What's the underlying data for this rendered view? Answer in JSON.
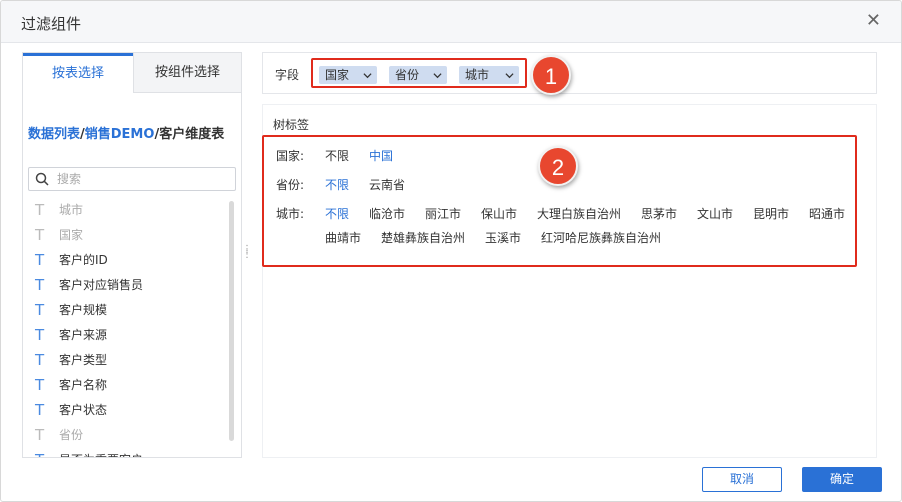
{
  "dialog": {
    "title": "过滤组件",
    "close_glyph": "✕"
  },
  "left_panel": {
    "tabs": [
      "按表选择",
      "按组件选择"
    ],
    "breadcrumb": {
      "part1": "数据列表",
      "sep1": "/",
      "part2": "销售DEMO",
      "sep2": "/",
      "current": "客户维度表"
    },
    "search_placeholder": "搜索",
    "field_type_glyph": "T",
    "fields": [
      {
        "label": "城市",
        "disabled": true
      },
      {
        "label": "国家",
        "disabled": true
      },
      {
        "label": "客户的ID",
        "disabled": false
      },
      {
        "label": "客户对应销售员",
        "disabled": false
      },
      {
        "label": "客户规模",
        "disabled": false
      },
      {
        "label": "客户来源",
        "disabled": false
      },
      {
        "label": "客户类型",
        "disabled": false
      },
      {
        "label": "客户名称",
        "disabled": false
      },
      {
        "label": "客户状态",
        "disabled": false
      },
      {
        "label": "省份",
        "disabled": true
      },
      {
        "label": "是否为重要客户",
        "disabled": false
      }
    ]
  },
  "field_bar": {
    "label": "字段",
    "chips": [
      "国家",
      "省份",
      "城市"
    ]
  },
  "annotations": [
    "1",
    "2"
  ],
  "preview": {
    "title": "树标签",
    "rows": [
      {
        "label": "国家:",
        "options": [
          {
            "text": "不限",
            "selected": false
          },
          {
            "text": "中国",
            "selected": true
          }
        ]
      },
      {
        "label": "省份:",
        "options": [
          {
            "text": "不限",
            "selected": true
          },
          {
            "text": "云南省",
            "selected": false
          }
        ]
      },
      {
        "label": "城市:",
        "options": [
          {
            "text": "不限",
            "selected": true
          },
          {
            "text": "临沧市",
            "selected": false
          },
          {
            "text": "丽江市",
            "selected": false
          },
          {
            "text": "保山市",
            "selected": false
          },
          {
            "text": "大理白族自治州",
            "selected": false
          },
          {
            "text": "思茅市",
            "selected": false
          },
          {
            "text": "文山市",
            "selected": false
          },
          {
            "text": "昆明市",
            "selected": false
          },
          {
            "text": "昭通市",
            "selected": false
          },
          {
            "text": "曲靖市",
            "selected": false
          },
          {
            "text": "楚雄彝族自治州",
            "selected": false
          },
          {
            "text": "玉溪市",
            "selected": false
          },
          {
            "text": "红河哈尼族彝族自治州",
            "selected": false
          }
        ]
      }
    ]
  },
  "footer": {
    "cancel_label": "取消",
    "ok_label": "确定"
  },
  "colors": {
    "accent": "#2a71d6",
    "highlight_border": "#e02b1c",
    "badge": "#e8472f",
    "chip_bg": "#cfdcf0"
  }
}
